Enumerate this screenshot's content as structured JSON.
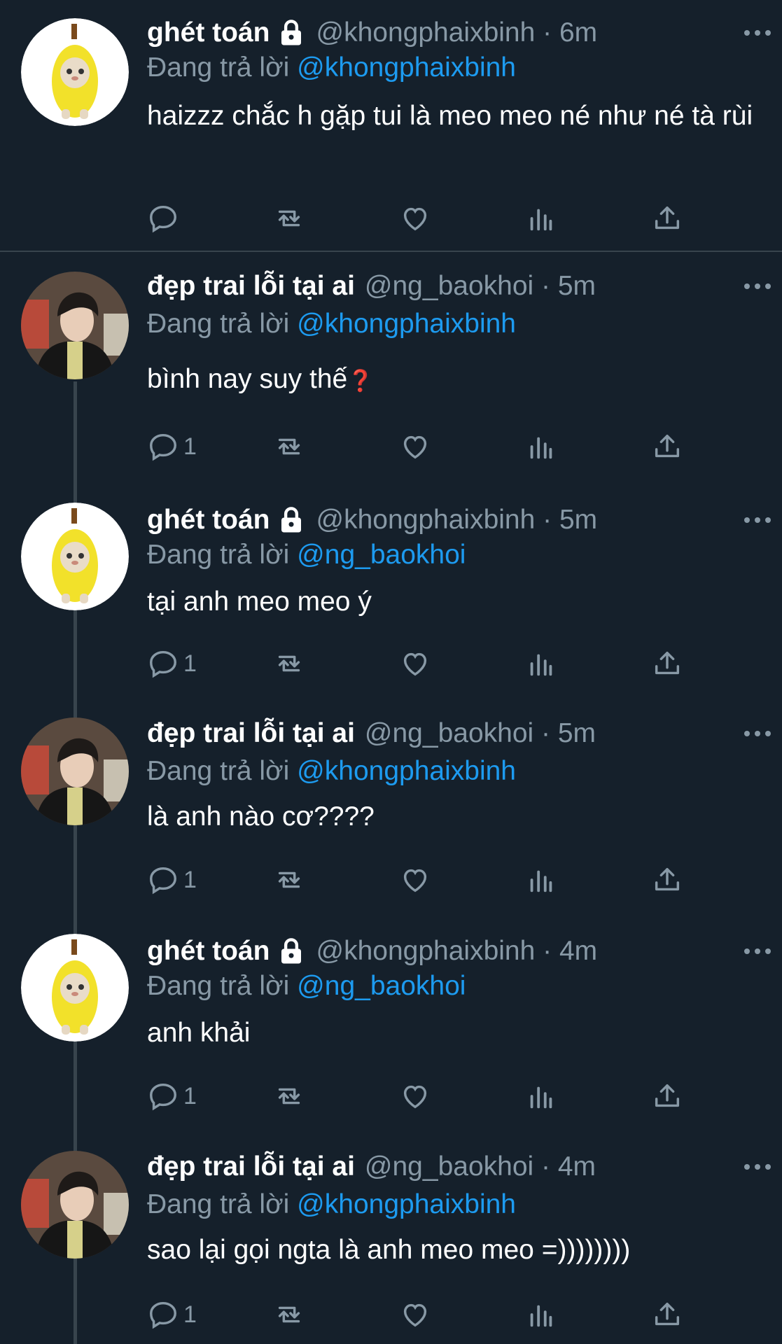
{
  "colors": {
    "background": "#15202b",
    "muted": "#8899a6",
    "accent": "#1d9bf0",
    "divider": "#38444d"
  },
  "tweets": [
    {
      "name": "ghét toán",
      "locked": true,
      "handle": "@khongphaixbinh",
      "time": "6m",
      "handle_time": "@khongphaixbinh · 6m",
      "reply_prefix": "Đang trả lời",
      "reply_to": "@khongphaixbinh",
      "text": "haizzz chắc h gặp tui là meo meo né như né tà rùi",
      "reply_count": "",
      "avatar": "banana-cat-avatar"
    },
    {
      "name": "đẹp trai lỗi tại ai",
      "locked": false,
      "handle": "@ng_baokhoi",
      "time": "5m",
      "handle_time": "@ng_baokhoi · 5m",
      "reply_prefix": "Đang trả lời",
      "reply_to": "@khongphaixbinh",
      "text": "bình nay suy thế",
      "emoji": "❓",
      "reply_count": "1",
      "avatar": "boy-photo-avatar"
    },
    {
      "name": "ghét toán",
      "locked": true,
      "handle": "@khongphaixbinh",
      "time": "5m",
      "handle_time": "@khongphaixbinh · 5m",
      "reply_prefix": "Đang trả lời",
      "reply_to": "@ng_baokhoi",
      "text": "tại anh meo meo ý",
      "reply_count": "1",
      "avatar": "banana-cat-avatar"
    },
    {
      "name": "đẹp trai lỗi tại ai",
      "locked": false,
      "handle": "@ng_baokhoi",
      "time": "5m",
      "handle_time": "@ng_baokhoi · 5m",
      "reply_prefix": "Đang trả lời",
      "reply_to": "@khongphaixbinh",
      "text": "là anh nào cơ????",
      "reply_count": "1",
      "avatar": "boy-photo-avatar"
    },
    {
      "name": "ghét toán",
      "locked": true,
      "handle": "@khongphaixbinh",
      "time": "4m",
      "handle_time": "@khongphaixbinh · 4m",
      "reply_prefix": "Đang trả lời",
      "reply_to": "@ng_baokhoi",
      "text": "anh khải",
      "reply_count": "1",
      "avatar": "banana-cat-avatar"
    },
    {
      "name": "đẹp trai lỗi tại ai",
      "locked": false,
      "handle": "@ng_baokhoi",
      "time": "4m",
      "handle_time": "@ng_baokhoi · 4m",
      "reply_prefix": "Đang trả lời",
      "reply_to": "@khongphaixbinh",
      "text": "sao lại gọi ngta là anh meo meo =))))))))",
      "reply_count": "1",
      "avatar": "boy-photo-avatar"
    }
  ]
}
